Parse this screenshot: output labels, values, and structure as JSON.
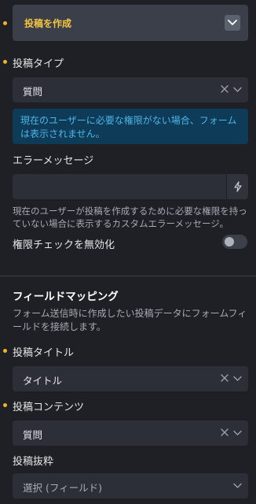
{
  "action": {
    "label": "投稿を作成"
  },
  "post_type": {
    "label": "投稿タイプ",
    "value": "質問",
    "info": "現在のユーザーに必要な権限がない場合、フォームは表示されません。"
  },
  "error_message": {
    "label": "エラーメッセージ",
    "value": "",
    "help": "現在のユーザーが投稿を作成するために必要な権限を持っていない場合に表示するカスタムエラーメッセージ。"
  },
  "disable_permission_check": {
    "label": "権限チェックを無効化",
    "enabled": false
  },
  "field_mapping": {
    "title": "フィールドマッピング",
    "description": "フォーム送信時に作成したい投稿データにフォームフィールドを接続します。",
    "post_title": {
      "label": "投稿タイトル",
      "value": "タイトル"
    },
    "post_content": {
      "label": "投稿コンテンツ",
      "value": "質問"
    },
    "post_excerpt": {
      "label": "投稿抜粋",
      "placeholder": "選択 (フィールド)"
    }
  },
  "colors": {
    "accent": "#f4c542",
    "required_dot": "#f0b429",
    "info_text": "#4fb5e8",
    "info_bg": "#0d3b58",
    "background": "#1f2025"
  },
  "icons": [
    "chevron-down-icon",
    "clear-x-icon",
    "bolt-icon"
  ]
}
